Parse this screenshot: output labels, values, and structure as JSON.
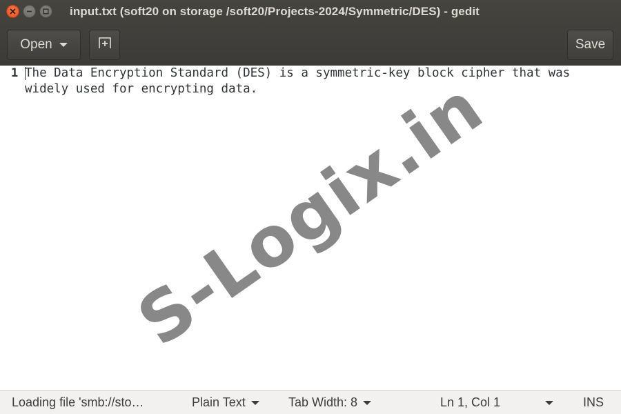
{
  "window": {
    "title": "input.txt (soft20 on storage /soft20/Projects-2024/Symmetric/DES) - gedit",
    "controls": [
      "close-icon",
      "minimize-icon",
      "maximize-icon"
    ]
  },
  "toolbar": {
    "open_label": "Open",
    "new_tab_icon": "new-document-icon",
    "save_label": "Save"
  },
  "editor": {
    "line_number": "1",
    "text": "The Data Encryption Standard (DES) is a symmetric-key block cipher that was widely used for encrypting data."
  },
  "watermark": "S-Logix.in",
  "statusbar": {
    "loading": "Loading file 'smb://sto…",
    "language": "Plain Text",
    "tab_width": "Tab Width: 8",
    "position": "Ln 1, Col 1",
    "mode": "INS"
  },
  "colors": {
    "header_bg": "#3c3b37",
    "close_button": "#e2531b",
    "title_text": "#dfdbd2",
    "editor_text": "#2e3436",
    "statusbar_bg": "#f2f1f0"
  }
}
